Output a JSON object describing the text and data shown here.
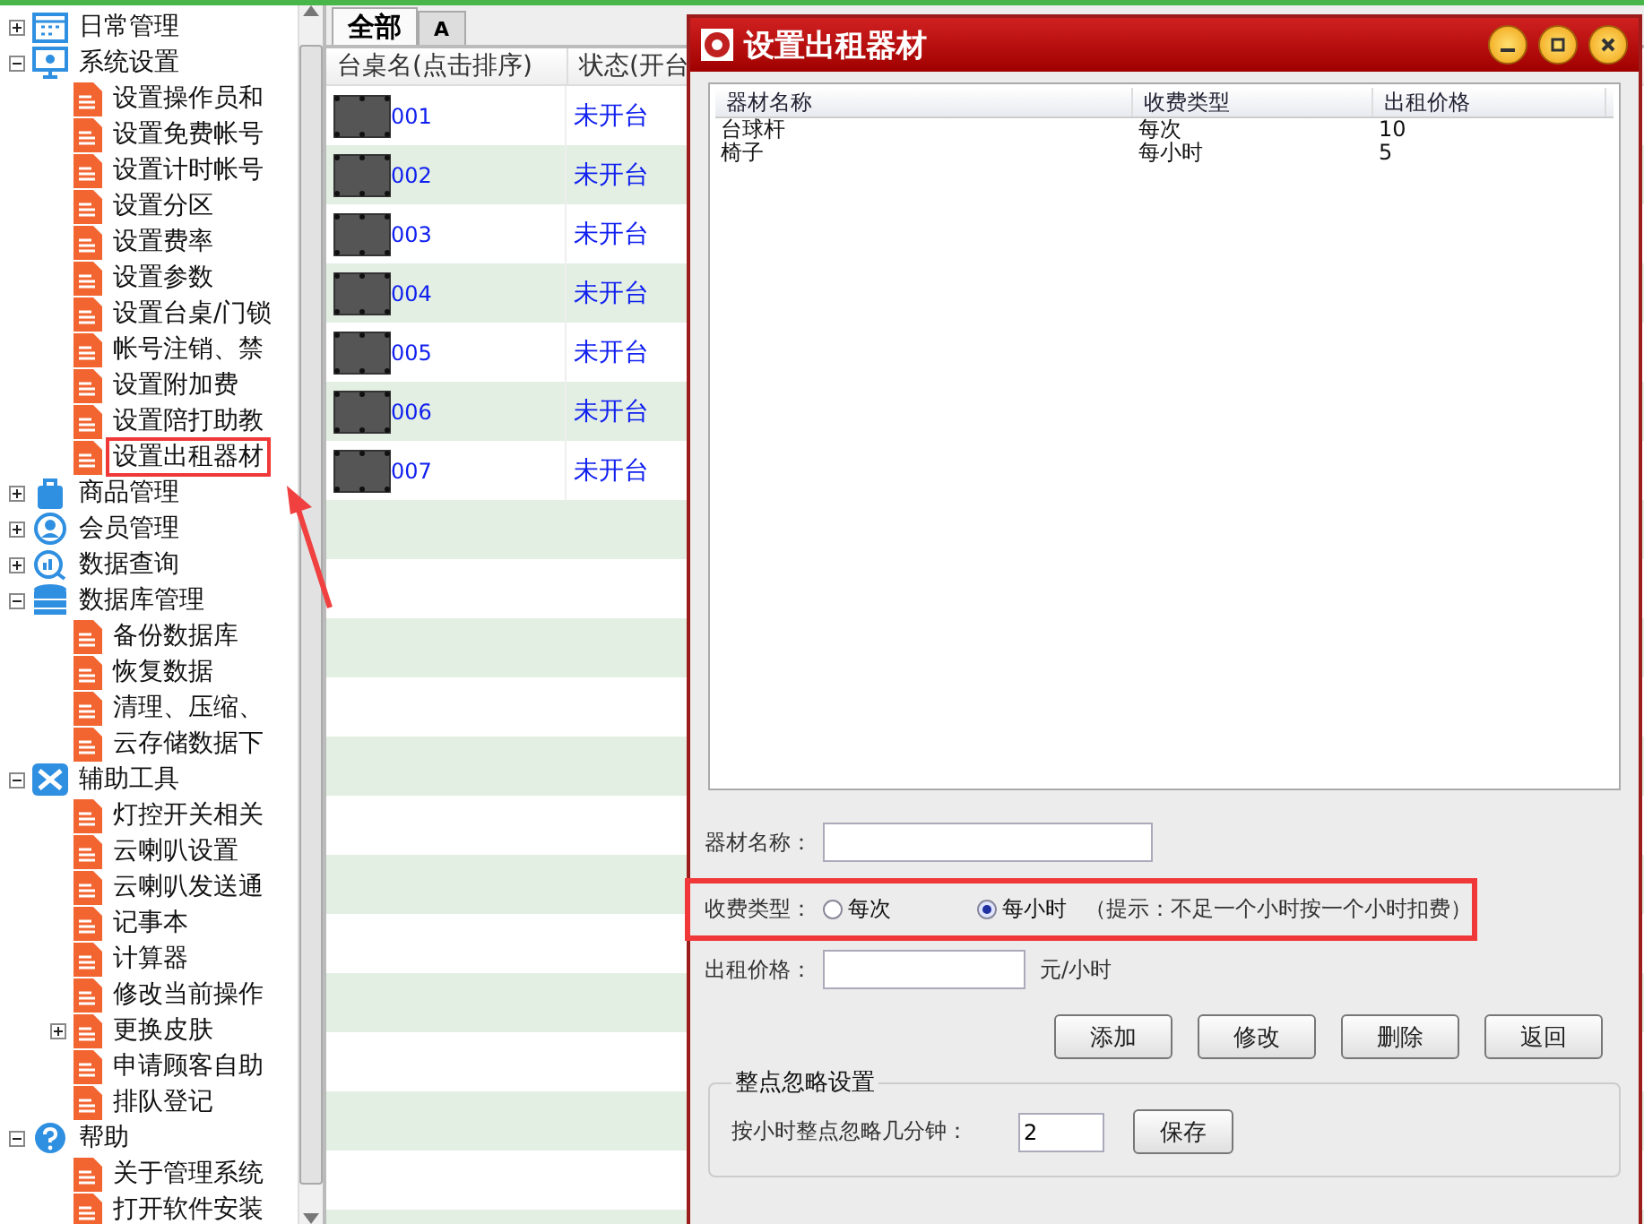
{
  "tree": [
    {
      "label": "日常管理",
      "expanded": false,
      "selected": false
    },
    {
      "label": "系统设置",
      "expanded": true,
      "selected": false,
      "children": [
        {
          "label": "设置操作员和",
          "selected": false
        },
        {
          "label": "设置免费帐号",
          "selected": false
        },
        {
          "label": "设置计时帐号",
          "selected": false
        },
        {
          "label": "设置分区",
          "selected": false
        },
        {
          "label": "设置费率",
          "selected": false
        },
        {
          "label": "设置参数",
          "selected": false
        },
        {
          "label": "设置台桌/门锁",
          "selected": false
        },
        {
          "label": "帐号注销、禁",
          "selected": false
        },
        {
          "label": "设置附加费",
          "selected": false
        },
        {
          "label": "设置陪打助教",
          "selected": false
        },
        {
          "label": "设置出租器材",
          "selected": true
        }
      ]
    },
    {
      "label": "商品管理",
      "expanded": false,
      "selected": false
    },
    {
      "label": "会员管理",
      "expanded": false,
      "selected": false
    },
    {
      "label": "数据查询",
      "expanded": false,
      "selected": false
    },
    {
      "label": "数据库管理",
      "expanded": true,
      "selected": false,
      "children": [
        {
          "label": "备份数据库",
          "selected": false
        },
        {
          "label": "恢复数据",
          "selected": false
        },
        {
          "label": "清理、压缩、",
          "selected": false
        },
        {
          "label": "云存储数据下",
          "selected": false
        }
      ]
    },
    {
      "label": "辅助工具",
      "expanded": true,
      "selected": false,
      "children": [
        {
          "label": "灯控开关相关",
          "selected": false
        },
        {
          "label": "云喇叭设置",
          "selected": false
        },
        {
          "label": "云喇叭发送通",
          "selected": false
        },
        {
          "label": "记事本",
          "selected": false
        },
        {
          "label": "计算器",
          "selected": false
        },
        {
          "label": "修改当前操作",
          "selected": false
        },
        {
          "label": "更换皮肤",
          "selected": false,
          "expanded": false
        },
        {
          "label": "申请顾客自助",
          "selected": false
        },
        {
          "label": "排队登记",
          "selected": false
        }
      ]
    },
    {
      "label": "帮助",
      "expanded": true,
      "selected": false,
      "children": [
        {
          "label": "关于管理系统",
          "selected": false
        },
        {
          "label": "打开软件安装",
          "selected": false
        }
      ]
    }
  ],
  "tabs": [
    {
      "label": "全部",
      "selected": true
    },
    {
      "label": "A",
      "selected": false
    }
  ],
  "table": {
    "columns": [
      "台桌名(点击排序)",
      "状态(开台"
    ],
    "rows": [
      {
        "name": "001",
        "status": "未开台"
      },
      {
        "name": "002",
        "status": "未开台"
      },
      {
        "name": "003",
        "status": "未开台"
      },
      {
        "name": "004",
        "status": "未开台"
      },
      {
        "name": "005",
        "status": "未开台"
      },
      {
        "name": "006",
        "status": "未开台"
      },
      {
        "name": "007",
        "status": "未开台"
      }
    ]
  },
  "dialog": {
    "title": "设置出租器材",
    "list": {
      "columns": [
        "器材名称",
        "收费类型",
        "出租价格"
      ],
      "rows": [
        [
          "台球杆",
          "每次",
          "10"
        ],
        [
          "椅子",
          "每小时",
          "5"
        ]
      ]
    },
    "name_field": {
      "label": "器材名称："
    },
    "fee_type": {
      "label": "收费类型：",
      "highlighted": true,
      "options": [
        {
          "label": "每次",
          "selected": false
        },
        {
          "label": "每小时",
          "selected": true
        }
      ],
      "hint": "（提示：不足一个小时按一个小时扣费）"
    },
    "price_field": {
      "label": "出租价格：",
      "unit": "元/小时"
    },
    "buttons": [
      "添加",
      "修改",
      "删除",
      "返回"
    ],
    "group": {
      "title": "整点忽略设置",
      "label": "按小时整点忽略几分钟：",
      "value": "2",
      "button": "保存"
    }
  }
}
